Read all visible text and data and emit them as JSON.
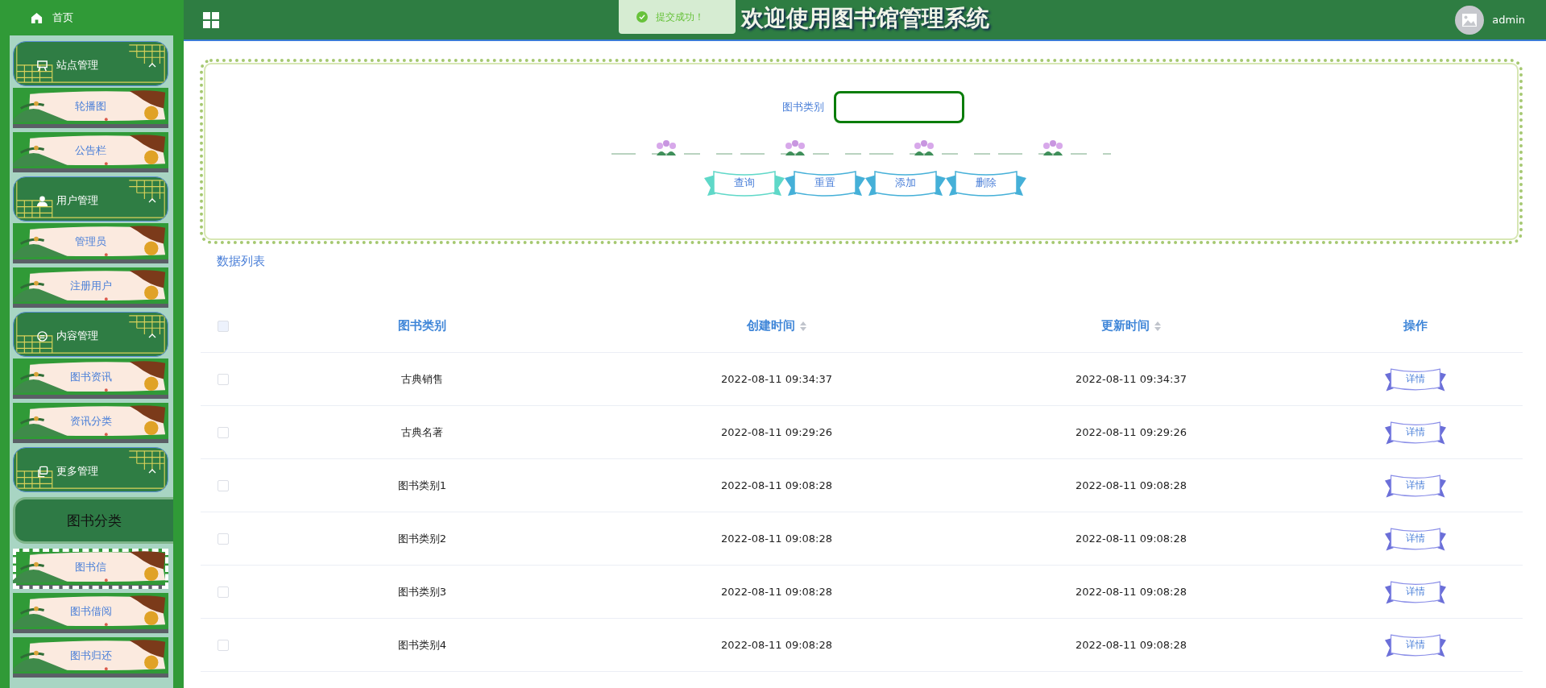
{
  "sidebar": {
    "home": {
      "label": "首页"
    },
    "groups": [
      {
        "label": "站点管理",
        "kind": "easel",
        "expanded": true,
        "children": [
          {
            "label": "轮播图",
            "selected": false,
            "focused": false
          },
          {
            "label": "公告栏",
            "selected": false,
            "focused": false
          }
        ]
      },
      {
        "label": "用户管理",
        "kind": "user",
        "expanded": true,
        "children": [
          {
            "label": "管理员",
            "selected": false,
            "focused": false
          },
          {
            "label": "注册用户",
            "selected": false,
            "focused": false
          }
        ]
      },
      {
        "label": "内容管理",
        "kind": "chat",
        "expanded": true,
        "children": [
          {
            "label": "图书资讯",
            "selected": false,
            "focused": false
          },
          {
            "label": "资讯分类",
            "selected": false,
            "focused": false
          }
        ]
      },
      {
        "label": "更多管理",
        "kind": "copy",
        "expanded": true,
        "children": [
          {
            "label": "图书分类",
            "selected": true,
            "focused": false
          },
          {
            "label": "图书信",
            "selected": false,
            "focused": true
          },
          {
            "label": "图书借阅",
            "selected": false,
            "focused": false
          },
          {
            "label": "图书归还",
            "selected": false,
            "focused": false
          }
        ]
      }
    ]
  },
  "header": {
    "title": "欢迎使用图书馆管理系统",
    "user": "admin"
  },
  "toast": {
    "message": "提交成功！"
  },
  "search": {
    "label": "图书类别",
    "buttons": [
      {
        "label": "查询",
        "color": "#5fd8c8"
      },
      {
        "label": "重置",
        "color": "#45b0d8"
      },
      {
        "label": "添加",
        "color": "#45b0d8"
      },
      {
        "label": "删除",
        "color": "#45b0d8"
      }
    ]
  },
  "section_title": "数据列表",
  "table": {
    "select_all": {
      "checked": false
    },
    "columns": [
      {
        "label": "图书类别",
        "sortable": false
      },
      {
        "label": "创建时间",
        "sortable": true
      },
      {
        "label": "更新时间",
        "sortable": true
      },
      {
        "label": "操作",
        "sortable": false
      }
    ],
    "rows": [
      {
        "checked": false,
        "cells": [
          "古典销售",
          "2022-08-11 09:34:37",
          "2022-08-11 09:34:37"
        ],
        "action": "详情"
      },
      {
        "checked": false,
        "cells": [
          "古典名著",
          "2022-08-11 09:29:26",
          "2022-08-11 09:29:26"
        ],
        "action": "详情"
      },
      {
        "checked": false,
        "cells": [
          "图书类别1",
          "2022-08-11 09:08:28",
          "2022-08-11 09:08:28"
        ],
        "action": "详情"
      },
      {
        "checked": false,
        "cells": [
          "图书类别2",
          "2022-08-11 09:08:28",
          "2022-08-11 09:08:28"
        ],
        "action": "详情"
      },
      {
        "checked": false,
        "cells": [
          "图书类别3",
          "2022-08-11 09:08:28",
          "2022-08-11 09:08:28"
        ],
        "action": "详情"
      },
      {
        "checked": false,
        "cells": [
          "图书类别4",
          "2022-08-11 09:08:28",
          "2022-08-11 09:08:28"
        ],
        "action": "详情"
      }
    ]
  }
}
